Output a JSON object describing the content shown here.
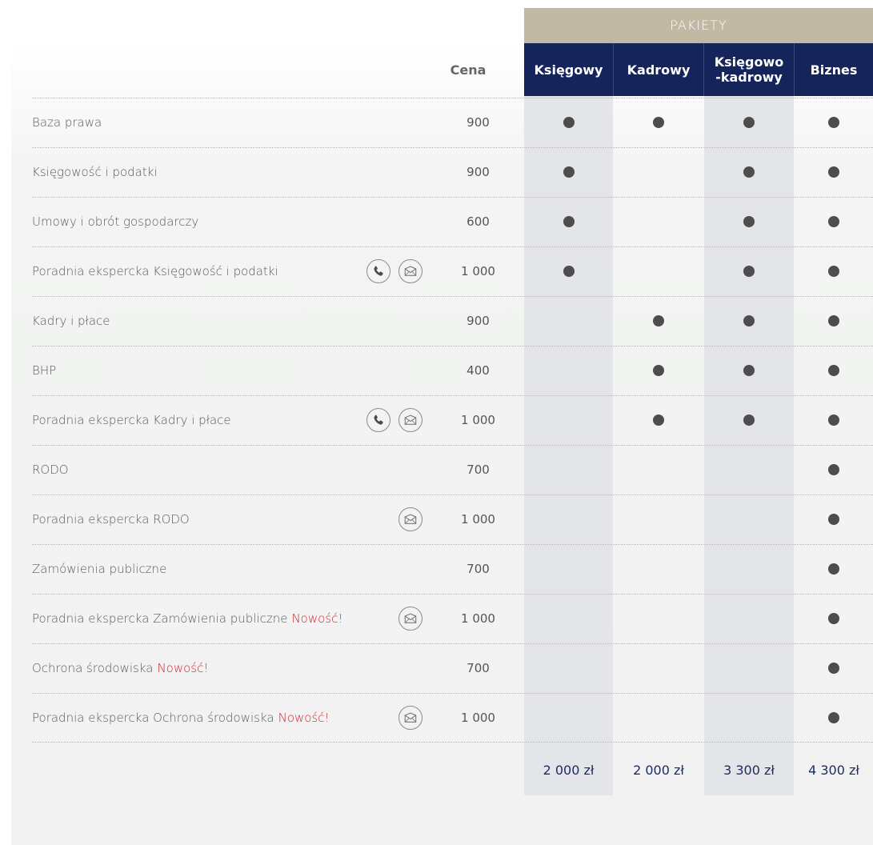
{
  "header": {
    "band_label": "PAKIETY",
    "price_col_label": "Cena",
    "packages": [
      "Księgowy",
      "Kadrowy",
      "Księgowo\n-kadrowy",
      "Biznes"
    ]
  },
  "icons": {
    "phone": "phone-icon",
    "mail": "mail-icon"
  },
  "rows": [
    {
      "name": "Baza prawa",
      "new_label": "",
      "price": "900",
      "phone": false,
      "mail": false,
      "included": [
        true,
        true,
        true,
        true
      ]
    },
    {
      "name": "Księgowość i podatki",
      "new_label": "",
      "price": "900",
      "phone": false,
      "mail": false,
      "included": [
        true,
        false,
        true,
        true
      ]
    },
    {
      "name": "Umowy i obrót gospodarczy",
      "new_label": "",
      "price": "600",
      "phone": false,
      "mail": false,
      "included": [
        true,
        false,
        true,
        true
      ]
    },
    {
      "name": "Poradnia ekspercka Księgowość i podatki",
      "new_label": "",
      "price": "1 000",
      "phone": true,
      "mail": true,
      "included": [
        true,
        false,
        true,
        true
      ]
    },
    {
      "name": "Kadry i płace",
      "new_label": "",
      "price": "900",
      "phone": false,
      "mail": false,
      "included": [
        false,
        true,
        true,
        true
      ]
    },
    {
      "name": "BHP",
      "new_label": "",
      "price": "400",
      "phone": false,
      "mail": false,
      "included": [
        false,
        true,
        true,
        true
      ]
    },
    {
      "name": "Poradnia ekspercka Kadry i płace",
      "new_label": "",
      "price": "1 000",
      "phone": true,
      "mail": true,
      "included": [
        false,
        true,
        true,
        true
      ]
    },
    {
      "name": "RODO",
      "new_label": "",
      "price": "700",
      "phone": false,
      "mail": false,
      "included": [
        false,
        false,
        false,
        true
      ]
    },
    {
      "name": "Poradnia ekspercka RODO",
      "new_label": "",
      "price": "1 000",
      "phone": false,
      "mail": true,
      "included": [
        false,
        false,
        false,
        true
      ]
    },
    {
      "name": "Zamówienia publiczne",
      "new_label": "",
      "price": "700",
      "phone": false,
      "mail": false,
      "included": [
        false,
        false,
        false,
        true
      ]
    },
    {
      "name": "Poradnia ekspercka Zamówienia publiczne",
      "new_label": "Nowość!",
      "price": "1 000",
      "phone": false,
      "mail": true,
      "included": [
        false,
        false,
        false,
        true
      ]
    },
    {
      "name": "Ochrona środowiska",
      "new_label": "Nowość!",
      "price": "700",
      "phone": false,
      "mail": false,
      "included": [
        false,
        false,
        false,
        true
      ]
    },
    {
      "name": "Poradnia ekspercka Ochrona środowiska",
      "new_label": "Nowość!",
      "price": "1 000",
      "phone": false,
      "mail": true,
      "included": [
        false,
        false,
        false,
        true
      ]
    }
  ],
  "totals": [
    "2 000 zł",
    "2 000 zł",
    "3 300 zł",
    "4 300 zł"
  ]
}
